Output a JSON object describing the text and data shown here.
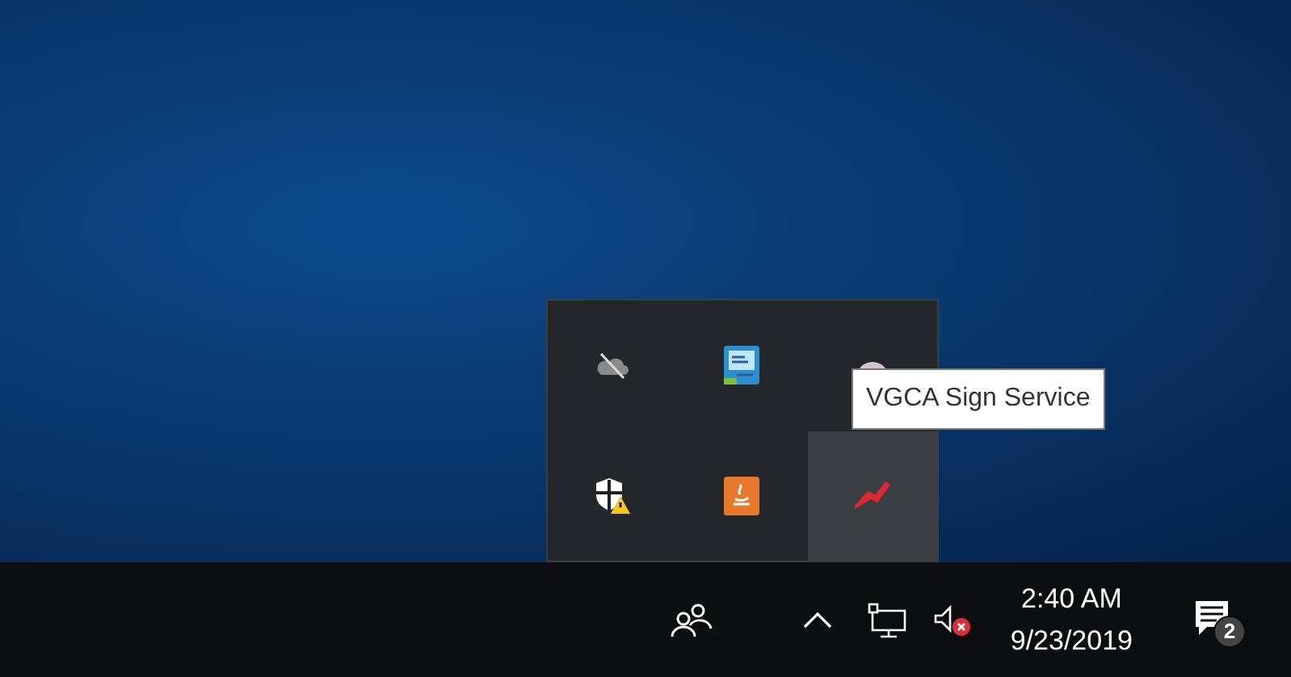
{
  "tray_flyout": {
    "icons": [
      {
        "kind": "cloud-off",
        "selected": false
      },
      {
        "kind": "network-app",
        "selected": false
      },
      {
        "kind": "disc",
        "selected": false
      },
      {
        "kind": "shield-warning",
        "selected": false
      },
      {
        "kind": "java",
        "selected": false
      },
      {
        "kind": "pen",
        "selected": true
      }
    ]
  },
  "tooltip": {
    "text": "VGCA Sign Service"
  },
  "taskbar": {
    "clock": {
      "time": "2:40 AM",
      "date": "9/23/2019"
    },
    "notifications": {
      "count": "2"
    },
    "volume_muted": true
  }
}
